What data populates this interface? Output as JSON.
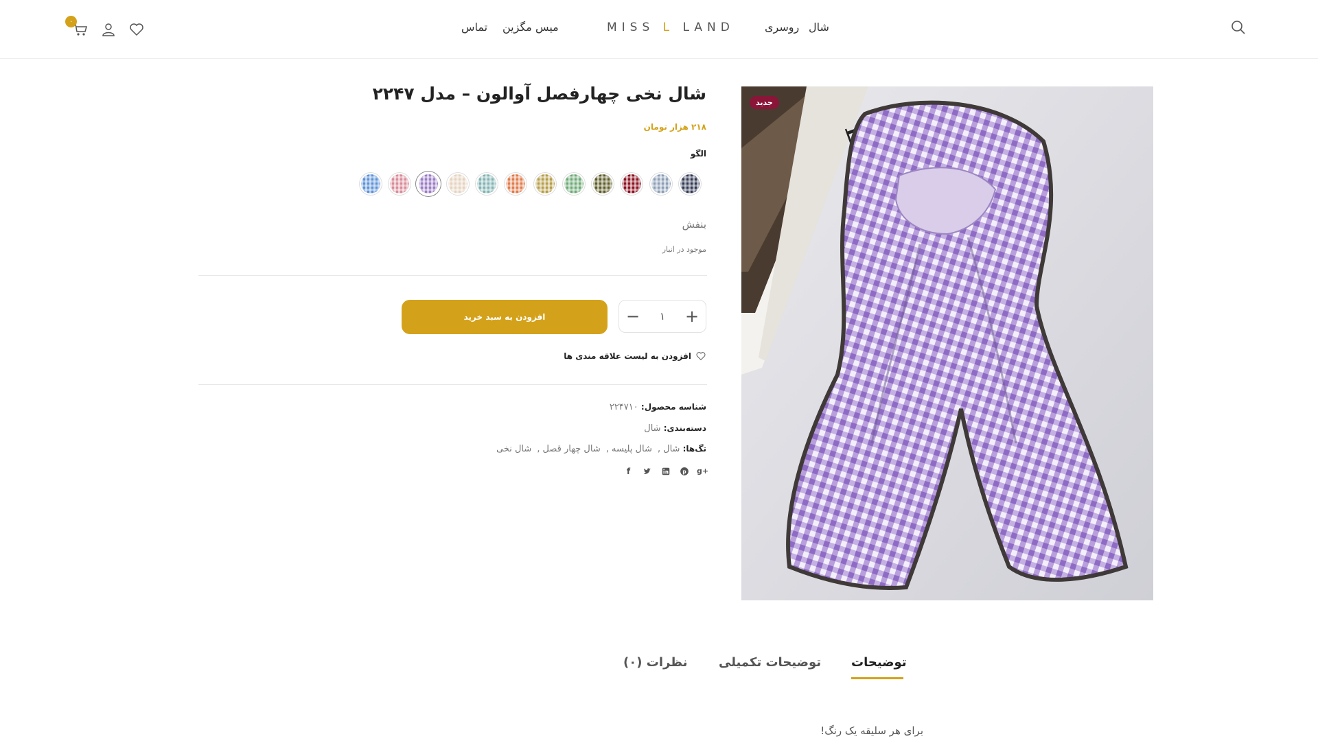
{
  "header": {
    "logo": {
      "part1": "MISS",
      "part2": "L",
      "part3": "LAND"
    },
    "nav_right": [
      {
        "label": "شال"
      },
      {
        "label": "روسری"
      }
    ],
    "nav_left": [
      {
        "label": "میس مگزین"
      },
      {
        "label": "تماس"
      }
    ],
    "cart_count": "۰"
  },
  "product": {
    "title": "شال نخی چهارفصل آوالون – مدل ۲۲۴۷",
    "price": "۲۱۸ هزار تومان",
    "pattern_label": "الگو",
    "selected_pattern": "بنفش",
    "stock": "موجود در انبار",
    "quantity": "۱",
    "add_to_cart": "افزودن به سبد خرید",
    "wishlist": "افزودن به لیست علاقه مندی ها",
    "badge": "جدید",
    "sku_label": "شناسه محصول:",
    "sku_value": "۲۲۴۷۱۰",
    "category_label": "دسته‌بندی:",
    "category_value": "شال",
    "tags_label": "تگ‌ها:",
    "tags": [
      "شال",
      "شال پلیسه",
      "شال چهار قصل",
      "شال نخی"
    ]
  },
  "swatches": [
    {
      "name": "navy-gingham",
      "color": "#2d3550"
    },
    {
      "name": "grey-blue-gingham",
      "color": "#8a9db5"
    },
    {
      "name": "red-gingham",
      "color": "#8b0f1f"
    },
    {
      "name": "olive-gingham",
      "color": "#5c5a24"
    },
    {
      "name": "green-gingham",
      "color": "#6aa873"
    },
    {
      "name": "mustard-gingham",
      "color": "#b59c47"
    },
    {
      "name": "orange-gingham",
      "color": "#e07a4a"
    },
    {
      "name": "teal-gingham",
      "color": "#7fb1b0"
    },
    {
      "name": "beige-gingham",
      "color": "#e4d2bd"
    },
    {
      "name": "purple-gingham",
      "color": "#9a7bc4",
      "selected": true
    },
    {
      "name": "pink-gingham",
      "color": "#d88a98"
    },
    {
      "name": "blue-gingham",
      "color": "#5a90d6"
    }
  ],
  "tabs": [
    {
      "label": "توضیحات",
      "active": true
    },
    {
      "label": "توضیحات تکمیلی"
    },
    {
      "label": "نظرات (۰)"
    }
  ],
  "description": "برای هر سلیقه یک رنگ!",
  "colors": {
    "accent": "#d4a21a",
    "badge": "#8a1538"
  },
  "icons": [
    "search-icon",
    "cart-icon",
    "user-icon",
    "heart-icon",
    "facebook-icon",
    "twitter-icon",
    "linkedin-icon",
    "pinterest-icon",
    "google-plus-icon"
  ]
}
